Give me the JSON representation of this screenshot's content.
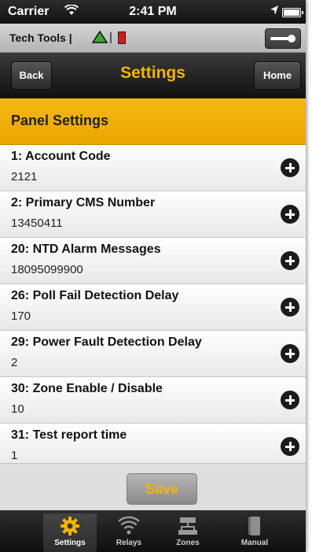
{
  "status_bar": {
    "carrier": "Carrier",
    "time": "2:41 PM"
  },
  "tech_bar": {
    "title": "Tech Tools |",
    "separator": "|"
  },
  "nav": {
    "back_label": "Back",
    "title": "Settings",
    "home_label": "Home"
  },
  "section": {
    "title": "Panel Settings"
  },
  "settings": [
    {
      "label": "1: Account Code",
      "value": "2121"
    },
    {
      "label": "2: Primary CMS Number",
      "value": "13450411"
    },
    {
      "label": "20: NTD Alarm Messages",
      "value": "18095099900"
    },
    {
      "label": "26: Poll Fail Detection Delay",
      "value": "170"
    },
    {
      "label": "29: Power Fault Detection Delay",
      "value": "2"
    },
    {
      "label": "30: Zone Enable / Disable",
      "value": "10"
    },
    {
      "label": "31: Test report time",
      "value": "1"
    }
  ],
  "save_label": "Save",
  "tabs": [
    {
      "label": "Settings",
      "icon": "gear-icon",
      "active": true
    },
    {
      "label": "Relays",
      "icon": "wifi-icon",
      "active": false
    },
    {
      "label": "Zones",
      "icon": "network-icon",
      "active": false
    },
    {
      "label": "Manual",
      "icon": "book-icon",
      "active": false
    }
  ],
  "colors": {
    "accent": "#f4b400",
    "header_bg": "#f0ad0a",
    "nav_bg": "#1a1a1a"
  }
}
